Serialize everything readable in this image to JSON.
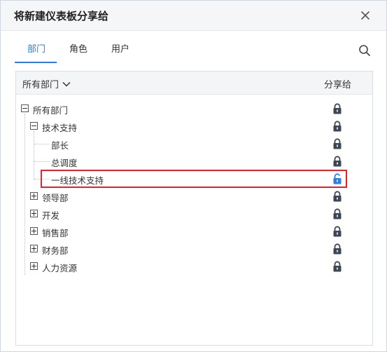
{
  "dialog": {
    "title": "将新建仪表板分享给"
  },
  "tabs": [
    {
      "label": "部门",
      "active": true
    },
    {
      "label": "角色",
      "active": false
    },
    {
      "label": "用户",
      "active": false
    }
  ],
  "panel": {
    "filter_label": "所有部门",
    "share_column": "分享给"
  },
  "tree": [
    {
      "label": "所有部门",
      "locked": true
    },
    {
      "label": "技术支持",
      "locked": true
    },
    {
      "label": "部长",
      "locked": true
    },
    {
      "label": "总调度",
      "locked": true
    },
    {
      "label": "一线技术支持",
      "locked": false
    },
    {
      "label": "领导部",
      "locked": true
    },
    {
      "label": "开发",
      "locked": true
    },
    {
      "label": "销售部",
      "locked": true
    },
    {
      "label": "财务部",
      "locked": true
    },
    {
      "label": "人力资源",
      "locked": true
    }
  ],
  "colors": {
    "accent": "#2b7de9",
    "lock_closed": "#3d4654",
    "lock_open": "#2b7de9",
    "highlight": "#e8212b"
  },
  "icons": {
    "close": "close-icon",
    "search": "search-icon",
    "filter_toggle": "chevron-down-icon",
    "lock": "lock-icon",
    "unlock": "unlock-icon",
    "expand": "plus-box-icon",
    "collapse": "minus-box-icon"
  }
}
